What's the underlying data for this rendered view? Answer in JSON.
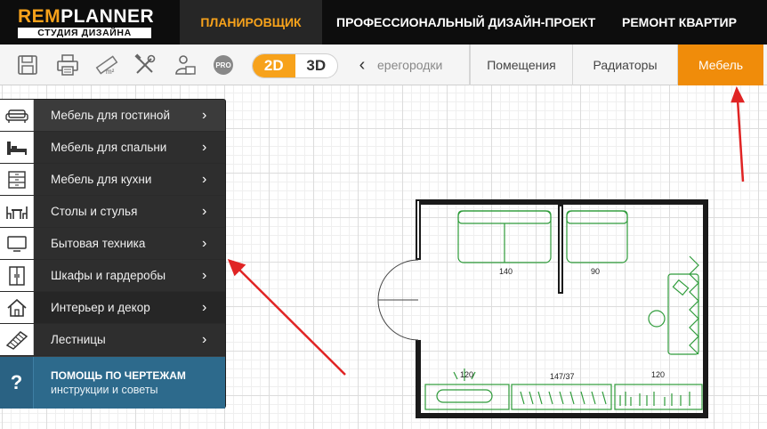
{
  "header": {
    "logo": {
      "main_accent": "REM",
      "main_rest": "PLANNER",
      "sub": "СТУДИЯ ДИЗАЙНА"
    },
    "nav": [
      {
        "label": "ПЛАНИРОВЩИК",
        "active": true
      },
      {
        "label": "ПРОФЕССИОНАЛЬНЫЙ ДИЗАЙН-ПРОЕКТ",
        "active": false
      },
      {
        "label": "РЕМОНТ КВАРТИР",
        "active": false
      }
    ]
  },
  "toolbar": {
    "icons": [
      "save-icon",
      "print-icon",
      "area-ruler-icon",
      "tools-icon",
      "designer-icon",
      "pro-icon"
    ],
    "pro_label": "PRO",
    "mode_2d": "2D",
    "mode_3d": "3D",
    "scroll_left": "‹",
    "tabs": [
      {
        "label": "ерегородки",
        "partial": true
      },
      {
        "label": "Помещения"
      },
      {
        "label": "Радиаторы"
      },
      {
        "label": "Мебель",
        "active": true
      }
    ]
  },
  "sidebar": {
    "items": [
      {
        "label": "Мебель для гостиной",
        "icon": "sofa-icon"
      },
      {
        "label": "Мебель для спальни",
        "icon": "bed-icon"
      },
      {
        "label": "Мебель для кухни",
        "icon": "kitchen-cabinet-icon"
      },
      {
        "label": "Столы и стулья",
        "icon": "table-chairs-icon"
      },
      {
        "label": "Бытовая техника",
        "icon": "tv-icon"
      },
      {
        "label": "Шкафы и гардеробы",
        "icon": "wardrobe-icon"
      },
      {
        "label": "Интерьер и декор",
        "icon": "house-icon"
      },
      {
        "label": "Лестницы",
        "icon": "stairs-icon"
      }
    ],
    "arrow": "›",
    "help": {
      "icon": "?",
      "title": "ПОМОЩЬ ПО ЧЕРТЕЖАМ",
      "subtitle": "инструкции и советы"
    }
  },
  "plan": {
    "labels": {
      "sofa_large": "140",
      "sofa_small": "90",
      "bottom_left": "120",
      "bottom_middle": "147/37",
      "bottom_right": "120"
    }
  },
  "colors": {
    "accent": "#f7a21b",
    "active_tab": "#f08c0a",
    "furniture": "#2e9b3a",
    "help_bg": "#2d6a8c",
    "arrow_red": "#e02424"
  }
}
